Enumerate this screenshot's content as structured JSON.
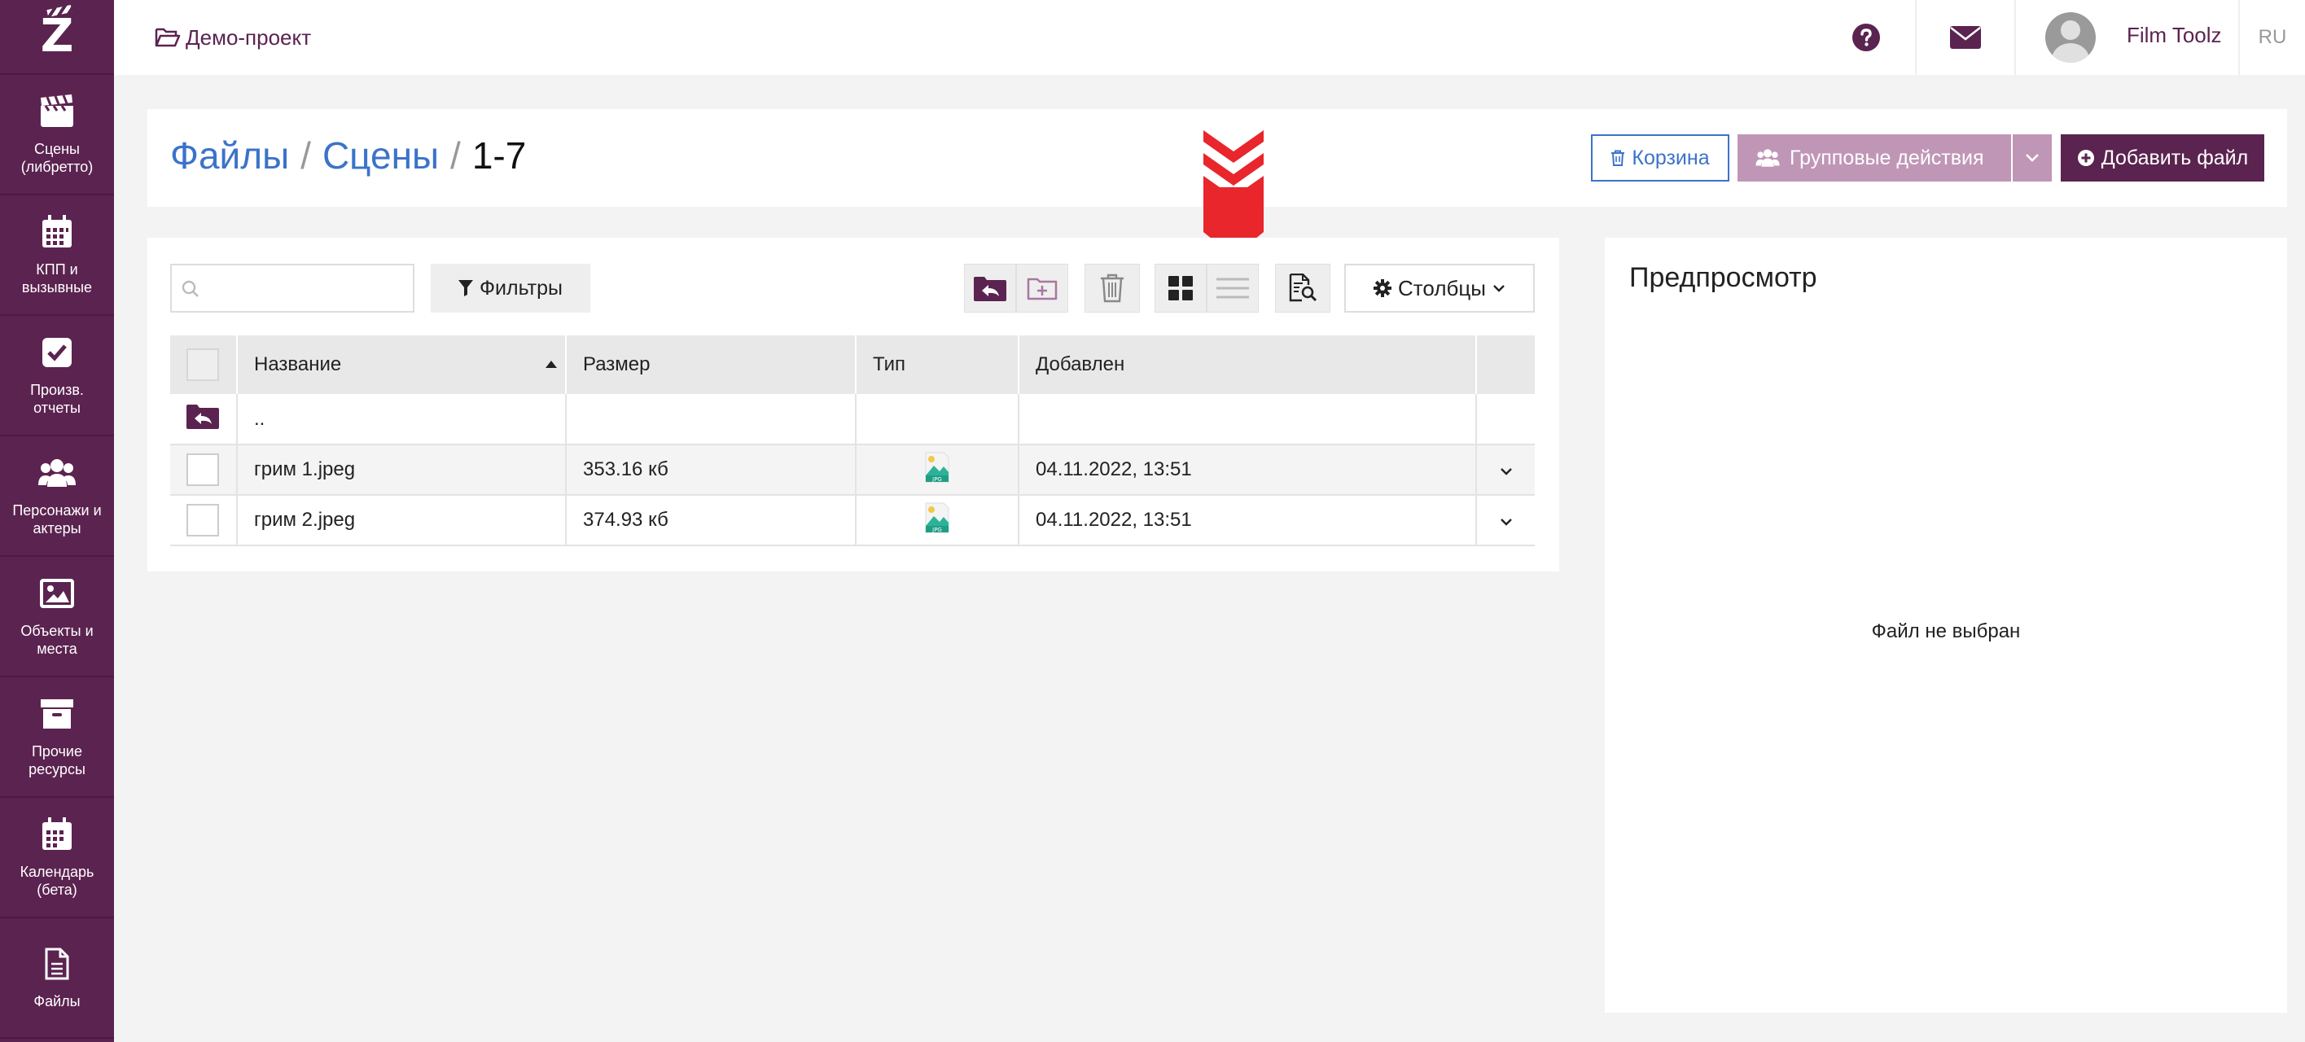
{
  "sidebar": {
    "logo": "Z",
    "items": [
      {
        "label": "Сцены (либретто)",
        "icon": "clapperboard-icon"
      },
      {
        "label": "КПП и вызывные",
        "icon": "calendar-grid-icon"
      },
      {
        "label": "Произв. отчеты",
        "icon": "checkbox-icon"
      },
      {
        "label": "Персонажи и актеры",
        "icon": "users-icon"
      },
      {
        "label": "Объекты и места",
        "icon": "image-icon"
      },
      {
        "label": "Прочие ресурсы",
        "icon": "archive-box-icon"
      },
      {
        "label": "Календарь (бета)",
        "icon": "calendar-icon"
      },
      {
        "label": "Файлы",
        "icon": "file-icon"
      }
    ]
  },
  "topbar": {
    "project": "Демо-проект",
    "user_name": "Film Toolz",
    "language": "RU"
  },
  "header": {
    "breadcrumb": [
      "Файлы",
      "Сцены",
      "1-7"
    ],
    "separator": "/",
    "trash_label": "Корзина",
    "group_actions_label": "Групповые действия",
    "add_file_label": "Добавить файл"
  },
  "toolbar": {
    "search_placeholder": "",
    "filters_label": "Фильтры",
    "columns_label": "Столбцы"
  },
  "table": {
    "columns": [
      "Название",
      "Размер",
      "Тип",
      "Добавлен"
    ],
    "parent_row": "..",
    "rows": [
      {
        "name": "грим 1.jpeg",
        "size": "353.16 кб",
        "type": "JPG",
        "added": "04.11.2022, 13:51"
      },
      {
        "name": "грим 2.jpeg",
        "size": "374.93 кб",
        "type": "JPG",
        "added": "04.11.2022, 13:51"
      }
    ]
  },
  "preview": {
    "title": "Предпросмотр",
    "empty_text": "Файл не выбран"
  },
  "colors": {
    "brand": "#5b2350",
    "brand_light": "#c096b7",
    "link": "#3b73c9",
    "arrow": "#e8262c"
  }
}
